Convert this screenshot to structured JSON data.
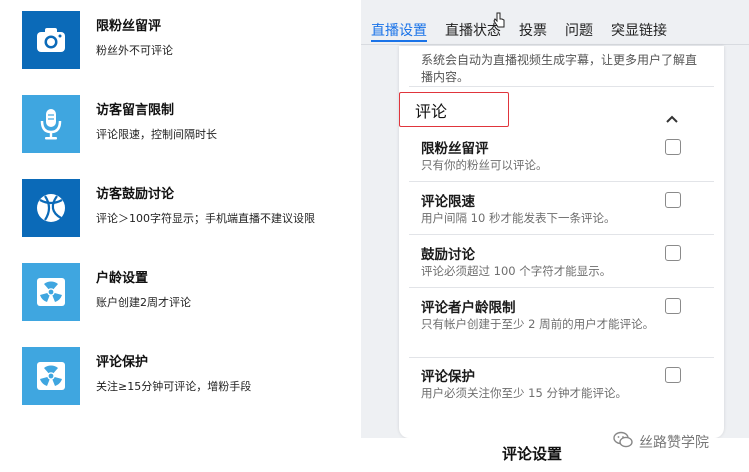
{
  "features": [
    {
      "title": "限粉丝留评",
      "desc": "粉丝外不可评论",
      "icon": "camera-icon",
      "color": "#0b6ab8"
    },
    {
      "title": "访客留言限制",
      "desc": "评论限速，控制间隔时长",
      "icon": "microphone-icon",
      "color": "#3fa6e0"
    },
    {
      "title": "访客鼓励讨论",
      "desc": "评论＞100字符显示；手机端直播不建议设限",
      "icon": "basketball-icon",
      "color": "#0b6ab8"
    },
    {
      "title": "户龄设置",
      "desc": "账户创建2周才评论",
      "icon": "radiation-icon",
      "color": "#3fa6e0"
    },
    {
      "title": "评论保护",
      "desc": "关注≥15分钟可评论，增粉手段",
      "icon": "radiation-icon",
      "color": "#3fa6e0"
    }
  ],
  "tabs": [
    "直播设置",
    "直播状态",
    "投票",
    "问题",
    "突显链接"
  ],
  "active_tab": 0,
  "top_note": "系统会自动为直播视频生成字幕，让更多用户了解直播内容。",
  "section_title": "评论",
  "options": [
    {
      "title": "限粉丝留评",
      "desc": "只有你的粉丝可以评论。",
      "checked": false
    },
    {
      "title": "评论限速",
      "desc": "用户间隔 10 秒才能发表下一条评论。",
      "checked": false
    },
    {
      "title": "鼓励讨论",
      "desc": "评论必须超过 100 个字符才能显示。",
      "checked": false
    },
    {
      "title": "评论者户龄限制",
      "desc": "只有帐户创建于至少 2 周前的用户才能评论。",
      "checked": false
    },
    {
      "title": "评论保护",
      "desc": "用户必须关注你至少 15 分钟才能评论。",
      "checked": false
    }
  ],
  "caption": "评论设置",
  "watermark": "丝路赞学院",
  "colors": {
    "accent": "#1a73e8",
    "highlight_border": "#e0353c"
  }
}
